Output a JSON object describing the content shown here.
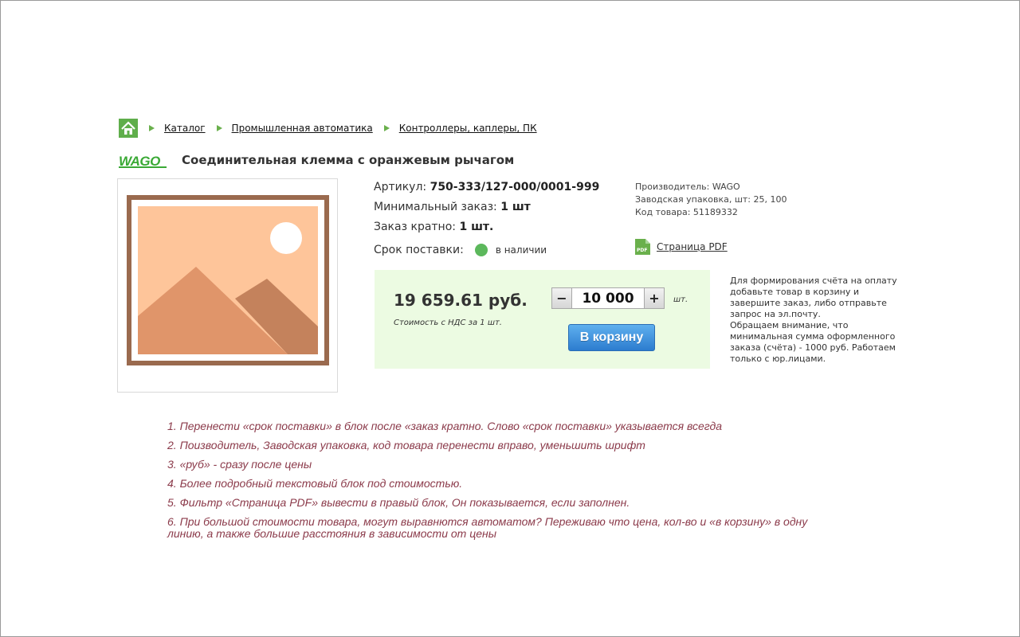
{
  "breadcrumb": {
    "home_icon": "home-icon",
    "items": [
      "Каталог",
      "Промышленная автоматика",
      "Контроллеры, каплеры, ПК"
    ]
  },
  "product": {
    "brand_logo_text": "WAGO",
    "title": "Соединительная клемма с оранжевым рычагом",
    "image_icon": "image-placeholder-icon",
    "article_label": "Артикул:",
    "article_value": "750-333/127-000/0001-999",
    "min_order_label": "Минимальный заказ:",
    "min_order_value": "1 шт",
    "multiple_label": "Заказ кратно:",
    "multiple_value": "1 шт.",
    "delivery_label": "Срок поставки:",
    "delivery_status": "в наличии",
    "status_color": "#5cb85c"
  },
  "meta": {
    "manufacturer": "Производитель: WAGO",
    "packaging": "Заводская упаковка, шт: 25, 100",
    "code": "Код товара: 51189332",
    "pdf_icon": "pdf-icon",
    "pdf_label": "Страница PDF"
  },
  "price_block": {
    "price": "19 659.61 руб.",
    "price_note": "Стоимость с НДС за 1 шт.",
    "minus_label": "−",
    "plus_label": "+",
    "quantity": "10 000",
    "unit": "шт.",
    "cart_label": "В корзину",
    "background": "#ecfbe2"
  },
  "side_note": "Для формирования счёта на оплату добавьте товар в корзину и завершите заказ, либо отправьте запрос на эл.почту.\nОбращаем внимание, что минимальная сумма оформленного заказа (счёта) - 1000 руб. Работаем только с юр.лицами.",
  "notes": [
    "1. Перенести «срок поставки» в блок после «заказ кратно. Слово «срок поставки» указывается всегда",
    "2. Поизводитель, Заводская упаковка, код товара перенести вправо, уменьшить шрифт",
    "3. «руб» - сразу после цены",
    "4. Более подробный текстовый блок  под стоимостью.",
    "5. Фильтр «Страница PDF» вывести в правый блок, Он показывается, если заполнен.",
    "6. При большой стоимости товара, могут выравнются автоматом? Переживаю что цена, кол-во и «в корзину» в одну линию, а также большие расстояния в зависимости от цены"
  ]
}
